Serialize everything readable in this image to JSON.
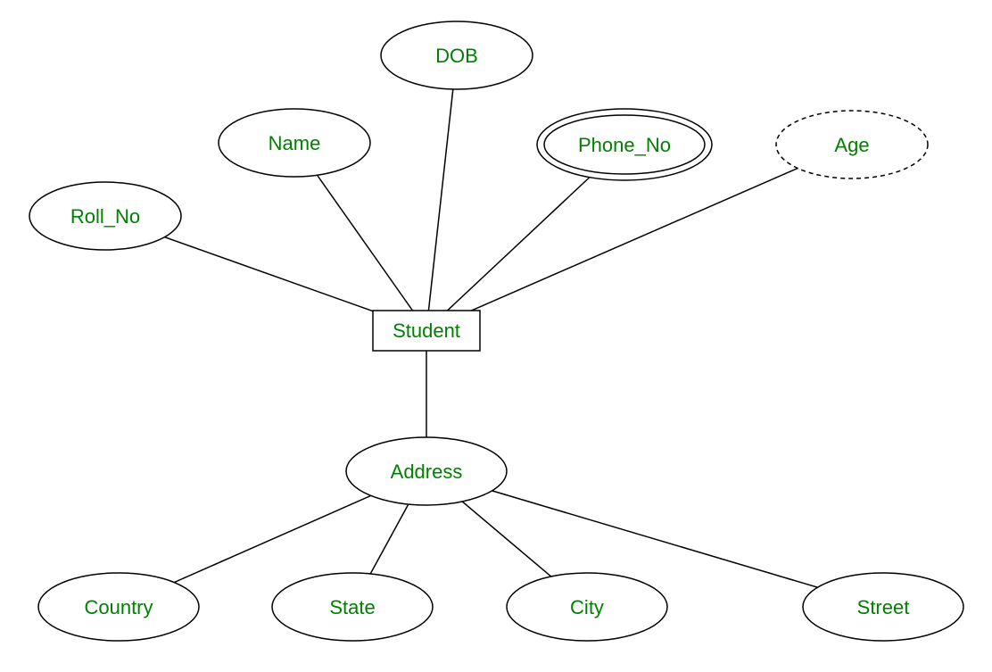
{
  "entity": {
    "label": "Student"
  },
  "attributes": {
    "roll_no": {
      "label": "Roll_No"
    },
    "name": {
      "label": "Name"
    },
    "dob": {
      "label": "DOB"
    },
    "phone_no": {
      "label": "Phone_No"
    },
    "age": {
      "label": "Age"
    },
    "address": {
      "label": "Address"
    },
    "country": {
      "label": "Country"
    },
    "state": {
      "label": "State"
    },
    "city": {
      "label": "City"
    },
    "street": {
      "label": "Street"
    }
  },
  "colors": {
    "text": "#008000",
    "stroke": "#000000",
    "bg": "#ffffff"
  }
}
